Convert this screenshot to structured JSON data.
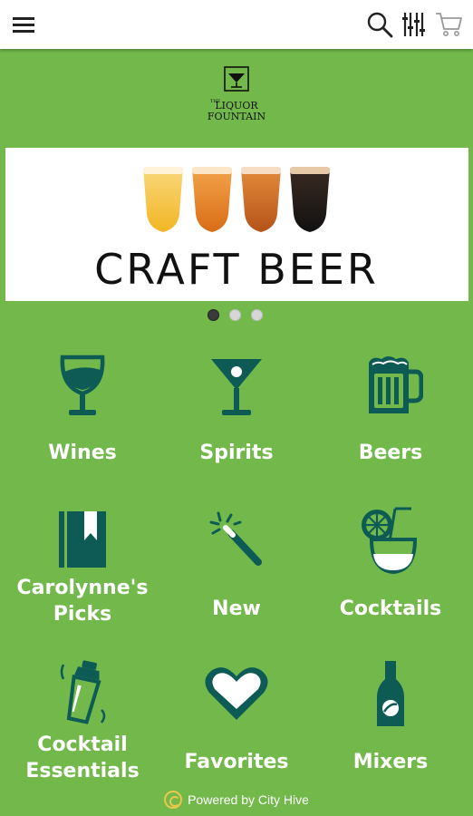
{
  "header": {
    "icons": [
      "hamburger-menu-icon",
      "search-icon",
      "filter-icon",
      "cart-icon"
    ]
  },
  "banner": {
    "title": "CRAFT BEER",
    "slides": 3,
    "active_slide": 1
  },
  "categories": [
    {
      "label": "Wines",
      "icon": "wine-glass-icon"
    },
    {
      "label": "Spirits",
      "icon": "martini-glass-icon"
    },
    {
      "label": "Beers",
      "icon": "beer-mug-icon"
    },
    {
      "label": "Carolynne's Picks",
      "icon": "bookmark-book-icon"
    },
    {
      "label": "New",
      "icon": "magic-wand-icon"
    },
    {
      "label": "Cocktails",
      "icon": "cocktail-icon"
    },
    {
      "label": "Cocktail Essentials",
      "icon": "shaker-icon"
    },
    {
      "label": "Favorites",
      "icon": "heart-icon"
    },
    {
      "label": "Mixers",
      "icon": "bottle-icon"
    }
  ],
  "footer": {
    "text": "Powered by City Hive"
  },
  "colors": {
    "background": "#72b84b",
    "icon": "#0e5a55",
    "text": "#ffffff"
  }
}
